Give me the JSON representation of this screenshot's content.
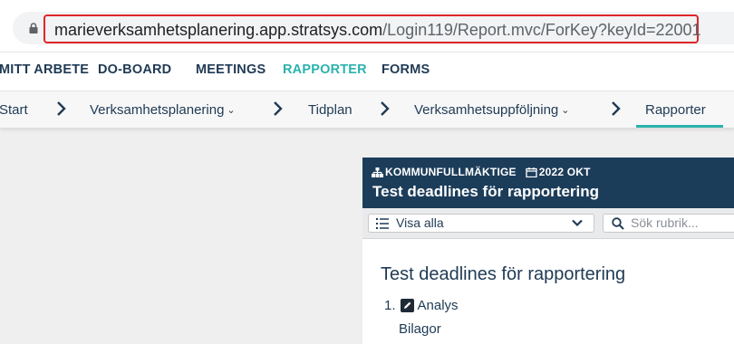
{
  "browser": {
    "url_host": "marieverksamhetsplanering.app.stratsys.com",
    "url_path": "/Login119/Report.mvc/ForKey?keyId=22001"
  },
  "topnav": {
    "items": [
      "MITT ARBETE",
      "DO-BOARD",
      "MEETINGS",
      "RAPPORTER",
      "FORMS"
    ],
    "active": "RAPPORTER"
  },
  "breadcrumbs": {
    "items": [
      {
        "label": "Start"
      },
      {
        "label": "Verksamhetsplanering"
      },
      {
        "label": "Tidplan"
      },
      {
        "label": "Verksamhetsuppföljning"
      },
      {
        "label": "Rapporter"
      }
    ],
    "active": "Rapporter"
  },
  "report": {
    "unit": "KOMMUNFULLMÄKTIGE",
    "period": "2022 OKT",
    "header_title": "Test deadlines för rapportering",
    "filter_value": "Visa alla",
    "search_placeholder": "Sök rubrik...",
    "content_title": "Test deadlines för rapportering",
    "items": [
      {
        "number": "1.",
        "label": "Analys",
        "sub_label": "Bilagor"
      }
    ]
  },
  "colors": {
    "accent": "#2bb3ad",
    "nav_text": "#1f3a55",
    "panel_header": "#1c3d5a",
    "highlight_frame": "#e0262b"
  }
}
